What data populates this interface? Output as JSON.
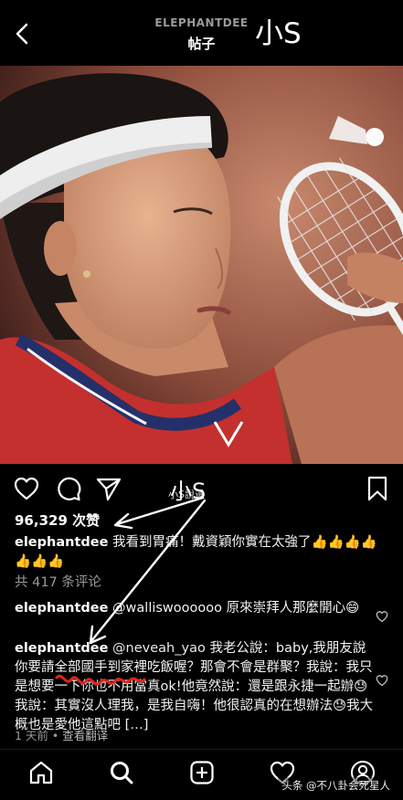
{
  "header": {
    "username": "ELEPHANTDEE",
    "title": "帖子",
    "watermark": "小S"
  },
  "post": {
    "action_watermark": "小S",
    "action_watermark_small": "小S說過",
    "likes": "96,329 次赞",
    "caption_user": "elephantdee",
    "caption_text": "我看到胃痛！戴資穎你實在太強了👍👍👍👍👍👍👍",
    "view_all": "共 417 条评论",
    "comments": [
      {
        "user": "elephantdee",
        "mention": "@walliswoooooo",
        "text": "原來崇拜人那麼開心😄"
      },
      {
        "user": "elephantdee",
        "mention": "@neveah_yao",
        "text": "我老公說：baby,我朋友說你要請全部國手到家裡吃飯喔？那會不會是群聚？我說：我只是想要一下你也不用當真ok!他竟然說：還是跟永捷一起辦😓我說：其實沒人理我，是我自嗨！他很認真的在想辦法😓我大概也是愛他這點吧 […]"
      }
    ],
    "time": "1 天前",
    "see_translation": "查看翻译"
  },
  "source": "头条 @不八卦会死星人",
  "colors": {
    "background": "#000000",
    "annotation": "#ffffff",
    "scribble": "#e0241b"
  },
  "icons": [
    "back-arrow-icon",
    "heart-icon",
    "comment-icon",
    "share-icon",
    "bookmark-icon",
    "home-icon",
    "search-icon",
    "add-post-icon",
    "activity-heart-icon",
    "profile-icon"
  ]
}
